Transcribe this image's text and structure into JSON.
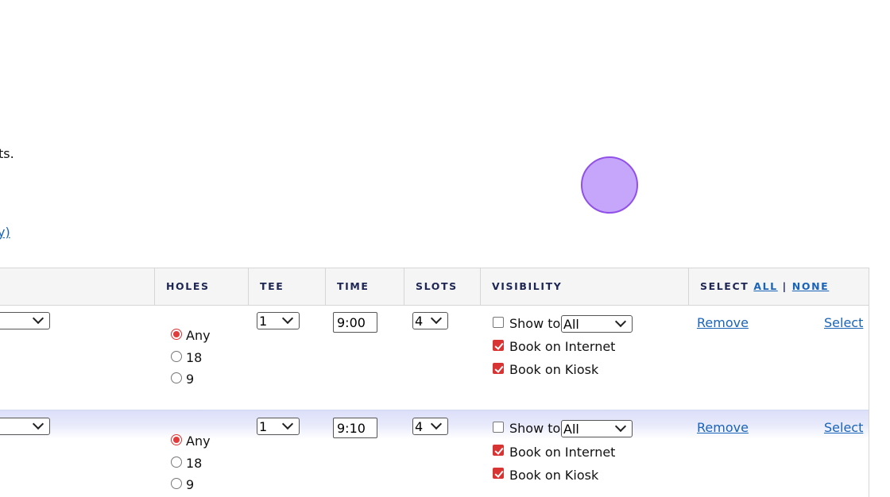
{
  "fragments": {
    "text_tail": "ts.",
    "link_tail": "y)"
  },
  "table": {
    "headers": {
      "holes": "HOLES",
      "tee": "TEE",
      "time": "TIME",
      "slots": "SLOTS",
      "visibility": "VISIBILITY",
      "select_prefix": "SELECT",
      "select_all": "ALL",
      "select_sep": "|",
      "select_none": "NONE"
    },
    "rows": [
      {
        "holes_options": [
          "Any",
          "18",
          "9"
        ],
        "holes_selected": "Any",
        "tee": "1",
        "time": "9:00",
        "slots": "4",
        "show_to_label": "Show to",
        "show_to_checked": false,
        "show_to_value": "All",
        "internet_label": "Book on Internet",
        "internet_checked": true,
        "kiosk_label": "Book on Kiosk",
        "kiosk_checked": true,
        "remove_label": "Remove",
        "select_label": "Select"
      },
      {
        "holes_options": [
          "Any",
          "18",
          "9"
        ],
        "holes_selected": "Any",
        "tee": "1",
        "time": "9:10",
        "slots": "4",
        "show_to_label": "Show to",
        "show_to_checked": false,
        "show_to_value": "All",
        "internet_label": "Book on Internet",
        "internet_checked": true,
        "kiosk_label": "Book on Kiosk",
        "kiosk_checked": true,
        "remove_label": "Remove",
        "select_label": "Select"
      }
    ]
  },
  "colors": {
    "header_text": "#1e2654",
    "link": "#1a64b8",
    "checkbox_checked": "#d93434",
    "row_highlight": "#dcdff9",
    "cursor_fill": "#c6a6fb",
    "cursor_border": "#9151e8"
  }
}
